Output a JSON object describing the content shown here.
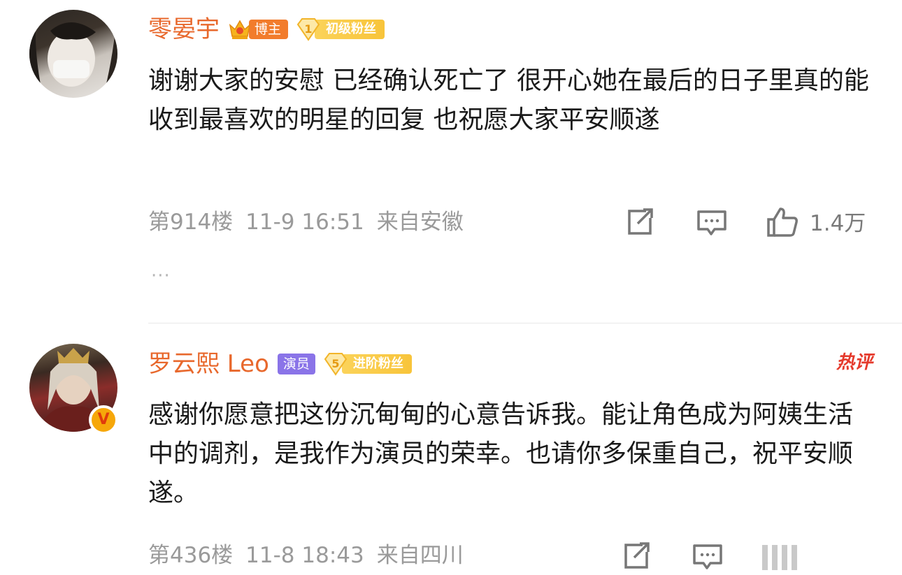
{
  "comments": [
    {
      "username": "零晏宇",
      "badge_blogger": "博主",
      "fan_badge": {
        "level": "1",
        "label": "初级粉丝"
      },
      "text": "谢谢大家的安慰 已经确认死亡了 很开心她在最后的日子里真的能收到最喜欢的明星的回复 也祝愿大家平安顺遂",
      "floor": "第914楼",
      "date": "11-9 16:51",
      "location": "来自安徽",
      "likes": "1.4万",
      "more": "···"
    },
    {
      "username": "罗云熙 Leo",
      "badge_actor": "演员",
      "fan_badge": {
        "level": "5",
        "label": "进阶粉丝"
      },
      "hot_label": "热评",
      "verified_mark": "V",
      "text": "感谢你愿意把这份沉甸甸的心意告诉我。能让角色成为阿姨生活中的调剂，是我作为演员的荣幸。也请你多保重自己，祝平安顺遂。",
      "floor": "第436楼",
      "date": "11-8 18:43",
      "location": "来自四川"
    }
  ],
  "colors": {
    "username": "#e8682c",
    "blogger_tag": "#f27c2c",
    "actor_tag": "#8a74e8",
    "fan_badge": "#f8c43a",
    "hot": "#e53a2c",
    "meta": "#9a9a9a"
  },
  "icons": [
    "share-icon",
    "comment-icon",
    "like-icon",
    "crown-icon",
    "fan-gem-icon",
    "verified-icon"
  ]
}
